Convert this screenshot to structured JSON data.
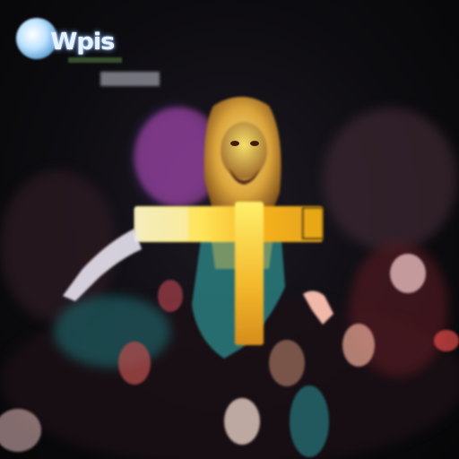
{
  "sign": {
    "text": "Wpis",
    "logo_color": "#bfe3ff"
  },
  "scene": {
    "subject": "person-in-costume-carrying-cross",
    "palette": {
      "cross": "#f4c21c",
      "cross_highlight": "#fff27a",
      "hair": "#e9c26a",
      "face": "#f2d35a",
      "robe": "#2e8c8c",
      "crowd_dark": "#1a1216",
      "crowd_red": "#8a1f2a",
      "crowd_teal": "#1f6b70",
      "magenta": "#b04aa8"
    }
  }
}
